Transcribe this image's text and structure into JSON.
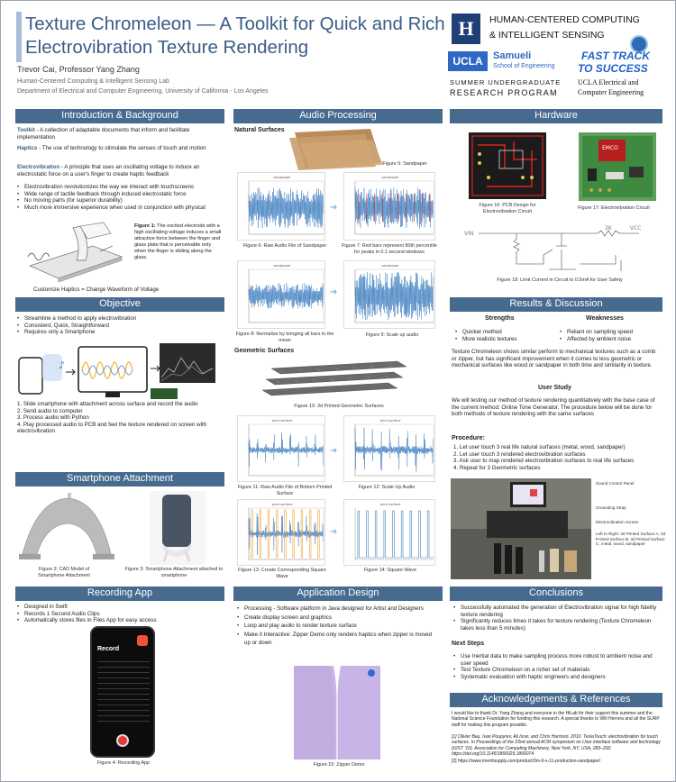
{
  "header": {
    "title": "Texture Chromeleon — A Toolkit for Quick and Rich Electrovibration Texture Rendering",
    "authors": "Trevor Cai, Professor Yang Zhang",
    "lab": "Human-Centered Computing & Intelligent Sensing Lab",
    "dept": "Department of Electrical and Computer Engineering, University of California - Los Angeles"
  },
  "logos": {
    "hcis1": "HUMAN-CENTERED COMPUTING",
    "hcis2": "& INTELLIGENT SENSING",
    "ucla": "UCLA",
    "samueli": "Samueli",
    "school": "School of Engineering",
    "ft1": "FAST TRACK",
    "ft2": "TO SUCCESS",
    "ece1": "UCLA Electrical and",
    "ece2": "Computer Engineering",
    "surp1": "SUMMER UNDERGRADUATE",
    "surp2": "RESEARCH PROGRAM"
  },
  "intro": {
    "heading": "Introduction & Background",
    "toolkit_term": "Toolkit",
    "toolkit_def": " - A collection of adaptable documents that inform and facilitate implementation",
    "haptics_term": "Haptics",
    "haptics_def": " - The use of technology to stimulate the senses of touch and motion",
    "ev_term": "Electrovibration",
    "ev_def": " - A principle that uses an oscillating voltage to induce an electrostatic force on a user's finger to create haptic feedback",
    "bullets": [
      "Electrovibration revolutionizes the way we interact with touchscreens",
      "Wide range of tactile feedback through induced electrostatic force",
      "No moving parts (for superior durability)",
      "Much more immersive experience when used in conjunction with physical vibration"
    ],
    "fig1_label": "Figure 1:",
    "fig1_text": " The excited electrode with a high oscillating voltage induces a small attractive force between the finger and glass plate that is perceivable only when the finger is sliding along the glass.",
    "fig1_sub": "Customize Haptics = Change Waveform of Voltage"
  },
  "objective": {
    "heading": "Objective",
    "bullets": [
      "Streamline a method to apply electrovibration",
      "Consistent, Quick, Straightforward",
      "Requires only a Smartphone"
    ],
    "steps": [
      "1.  Slide smartphone with attachment across surface and record the audio",
      "2.  Send audio to computer",
      "3.  Process audio with Python",
      "4.  Play processed audio to PCB and feel the texture rendered on screen with electrovibration"
    ]
  },
  "smartphone": {
    "heading": "Smartphone Attachment",
    "fig2": "Figure 2: CAD Model of Smartphone Attachment",
    "fig3": "Figure 3: Smartphone Attachment attached to smartphone"
  },
  "recording": {
    "heading": "Recording App",
    "bullets": [
      "Designed in Swift",
      "Records 1 Second Audio Clips",
      "Automatically stores files in Files App for easy access"
    ],
    "app_title": "Record",
    "fig4": "Figure 4: Recording App"
  },
  "audio": {
    "heading": "Audio Processing",
    "natural": "Natural Surfaces",
    "fig5": "Figure 5: Sandpaper",
    "fig6": "Figure 6: Raw Audio File of Sandpaper",
    "fig7": "Figure 7: Red bars represent 80th percentile for peaks in 0.1 second windows",
    "fig8": "Figure 8: Normalize by bringing all bars to the mean",
    "fig9": "Figure 9: Scale up audio",
    "geometric": "Geometric Surfaces",
    "fig10": "Figure 10: 3d Printed Geometric Surfaces",
    "fig11": "Figure 11: Raw Audio File of Bottom Printed Surface",
    "fig12": "Figure 12: Scale Up Audio",
    "fig13": "Figure 13: Create Corresponding Square Wave",
    "fig14": "Figure 14: Square Wave",
    "plot_title": "sandpaper",
    "plot_title2": "print surface"
  },
  "appdesign": {
    "heading": "Application Design",
    "bullets": [
      "Processing - Software platform in Java designed for Artist and Designers",
      "Create display screen and graphics",
      "Loop and play audio to render texture surface",
      "Make it Interactive: Zipper Demo only renders haptics when zipper is moved up or down"
    ],
    "fig15": "Figure 15: Zipper Demo"
  },
  "hardware": {
    "heading": "Hardware",
    "fig16": "Figure 16: PCB Design for Electrovibration Circuit",
    "fig17": "Figure 17: Electrovibration Circuit",
    "fig18": "Figure 18: Limit Current in Circuit to 0.5mA for User Safety",
    "vin": "VIN",
    "vcc": "VCC",
    "r1": "2K",
    "emco": "EMCO"
  },
  "results": {
    "heading": "Results & Discussion",
    "strengths_h": "Strengths",
    "weak_h": "Weaknesses",
    "strengths": [
      "Quicker method",
      "More realistic textures"
    ],
    "weaknesses": [
      "Reliant on sampling speed",
      "Affected by ambient noise"
    ],
    "para": "Texture Chromeleon shows similar perform to mechanical textures such as a comb or zipper, but has significant improvement when it comes to less geometric or mechanical surfaces like wood or sandpaper in both time and similarity in texture.",
    "study_h": "User Study",
    "study": "We will testing our method of texture rendering quantitatively with the base case of the current method: Online Tone Generator. The procedure below will be done for both methods of texture rendering with the same surfaces",
    "proc_h": "Procedure:",
    "proc": [
      "1.  Let user touch 3 real life natural surfaces (metal, wood, sandpaper)",
      "2.  Let user touch 3 rendered electrovibration surfaces",
      "3.  Ask user to map rendered electrovibration surfaces to real life surfaces",
      "4.  Repeat for 3 Geometric surfaces"
    ],
    "lab_labels": [
      "Sound Control Panel",
      "Grounding Strap",
      "Electrovibration Screen",
      "Left to Right: 3d Printed Surface A, 3d Printed Surface B, 3d Printed Surface C, metal, wood, sandpaper"
    ]
  },
  "conclusions": {
    "heading": "Conclusions",
    "bullets": [
      "Successfully automated the generation of Electrovibration signal for high fidelity texture rendering",
      "Significantly reduces times it takes for texture rendering (Texture Chromeleon takes less than 5 minutes)"
    ],
    "next_h": "Next Steps",
    "next": [
      "Use Inertial data to make sampling process more robust to ambient noise and user speed",
      "Test Texture Chromeleon on a richer set of materials",
      "Systematic evaluation with haptic engineers and designers"
    ]
  },
  "ack": {
    "heading": "Acknowledgements & References",
    "text": "I would like to thank Dr. Yang Zhang and everyone in the HiLab for their support this summer and the National Science Foundation for funding this research. A special thanks to Will Herrera and all the SURP staff for making this program possible.",
    "ref1": "[1] Olivier Bau, Ivan Poupyrev, Ali Israr, and Chris Harrison. 2010. TeslaTouch: electrovibration for touch surfaces. In Proceedings of the 23nd annual ACM symposium on User interface software and technology (UIST '10). Association for Computing Machinery, New York, NY, USA, 283–292. https://doi.org/10.1145/1866029.1866074",
    "ref2": "[2] https://www.merritsupply.com/product/3m-9-x-11-production-sandpaper/"
  },
  "colors": {
    "heading_bg": "#476a8f",
    "title": "#3a5d86",
    "accent": "#3b5f8a",
    "wave": "#3f7fbf"
  }
}
